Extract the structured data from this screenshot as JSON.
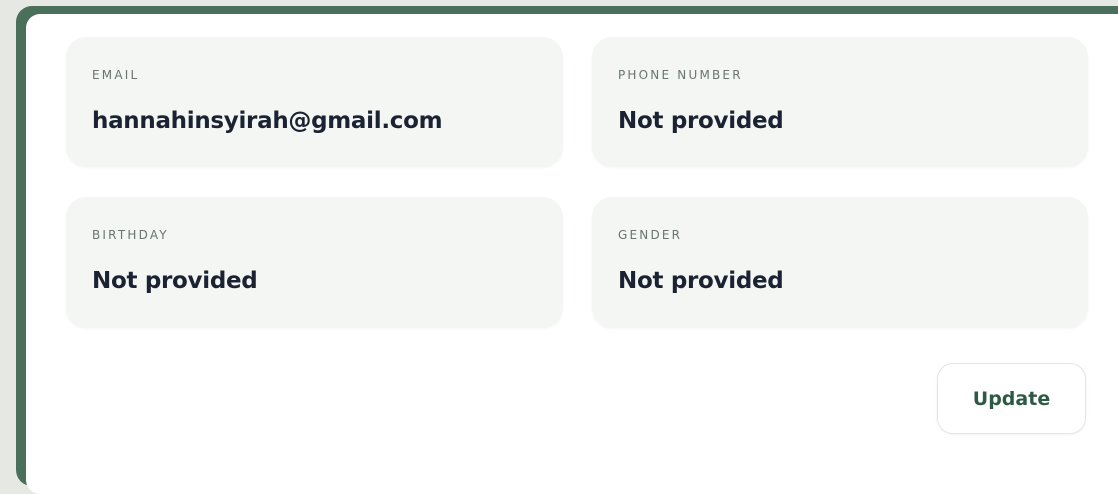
{
  "profile": {
    "fields": [
      {
        "label": "EMAIL",
        "value": "hannahinsyirah@gmail.com"
      },
      {
        "label": "PHONE NUMBER",
        "value": "Not provided"
      },
      {
        "label": "BIRTHDAY",
        "value": "Not provided"
      },
      {
        "label": "GENDER",
        "value": "Not provided"
      }
    ],
    "update_label": "Update"
  },
  "colors": {
    "frame_border": "#4a6f5b",
    "tile_background": "#f3f6f3",
    "value_text": "#1b2333",
    "label_text": "#6b7471",
    "button_text": "#2e5a44"
  }
}
